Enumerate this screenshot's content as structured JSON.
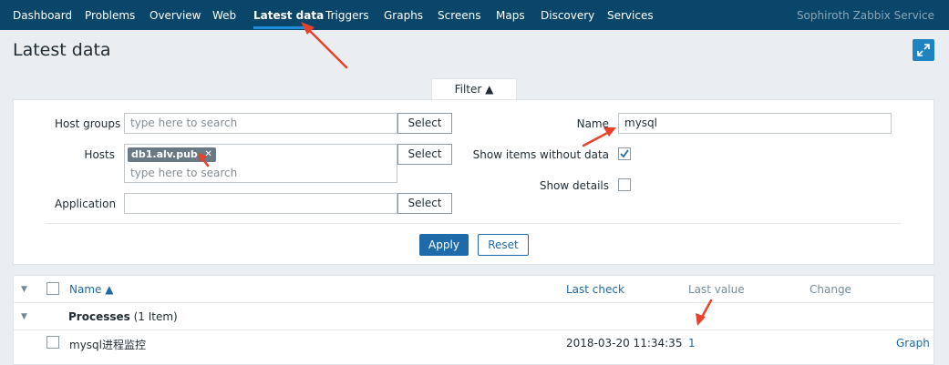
{
  "topnav": {
    "items": [
      {
        "label": "Dashboard",
        "active": false
      },
      {
        "label": "Problems",
        "active": false
      },
      {
        "label": "Overview",
        "active": false
      },
      {
        "label": "Web",
        "active": false
      },
      {
        "label": "Latest data",
        "active": true
      },
      {
        "label": "Triggers",
        "active": false
      },
      {
        "label": "Graphs",
        "active": false
      },
      {
        "label": "Screens",
        "active": false
      },
      {
        "label": "Maps",
        "active": false
      },
      {
        "label": "Discovery",
        "active": false
      },
      {
        "label": "Services",
        "active": false
      }
    ],
    "brand": "Sophiroth Zabbix Service"
  },
  "page": {
    "title": "Latest data"
  },
  "filter": {
    "tab_label": "Filter ▲",
    "host_groups": {
      "label": "Host groups",
      "placeholder": "type here to search",
      "select_label": "Select"
    },
    "hosts": {
      "label": "Hosts",
      "selected_tag": "db1.alv.pub",
      "placeholder": "type here to search",
      "select_label": "Select"
    },
    "application": {
      "label": "Application",
      "value": "",
      "select_label": "Select"
    },
    "name": {
      "label": "Name",
      "value": "mysql"
    },
    "show_items_without_data": {
      "label": "Show items without data",
      "checked": true
    },
    "show_details": {
      "label": "Show details",
      "checked": false
    },
    "apply_label": "Apply",
    "reset_label": "Reset"
  },
  "table": {
    "columns": {
      "name": "Name ▲",
      "last_check": "Last check",
      "last_value": "Last value",
      "change": "Change"
    },
    "group": {
      "name": "Processes",
      "count": "(1 Item)"
    },
    "rows": [
      {
        "name": "mysql进程监控",
        "last_check": "2018-03-20 11:34:35",
        "last_value": "1",
        "change": "",
        "action": "Graph"
      }
    ]
  },
  "colors": {
    "nav_bg": "#0a466a",
    "accent": "#1f6aa8",
    "annotation_arrow": "#e8412c"
  }
}
